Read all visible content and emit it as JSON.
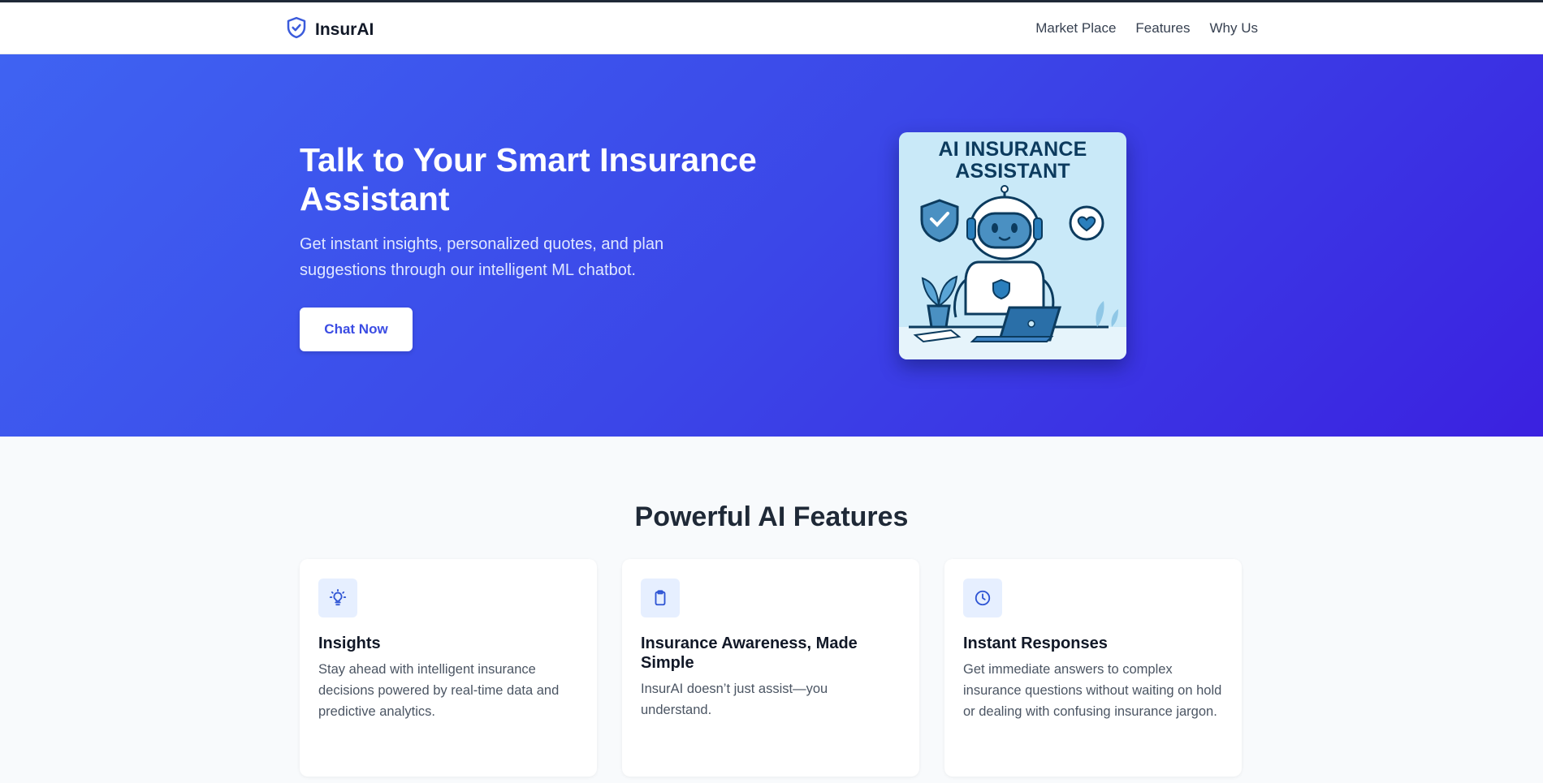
{
  "header": {
    "brand": "InsurAI",
    "nav": [
      {
        "label": "Market Place"
      },
      {
        "label": "Features"
      },
      {
        "label": "Why Us"
      }
    ]
  },
  "hero": {
    "title": "Talk to Your Smart Insurance Assistant",
    "subtitle": "Get instant insights, personalized quotes, and plan suggestions through our intelligent ML chatbot.",
    "cta_label": "Chat Now",
    "image_title_line1": "AI INSURANCE",
    "image_title_line2": "ASSISTANT"
  },
  "features": {
    "heading": "Powerful AI Features",
    "cards": [
      {
        "icon": "lightbulb-icon",
        "title": "Insights",
        "text": "Stay ahead with intelligent insurance decisions powered by real-time data and predictive analytics."
      },
      {
        "icon": "clipboard-icon",
        "title": "Insurance Awareness, Made Simple",
        "text": "InsurAI doesn’t just assist—you understand."
      },
      {
        "icon": "clock-icon",
        "title": "Instant Responses",
        "text": "Get immediate answers to complex insurance questions without waiting on hold or dealing with confusing insurance jargon."
      }
    ]
  },
  "colors": {
    "accent": "#3b4ce3",
    "hero_start": "#3f63f2",
    "hero_end": "#3b21e0",
    "icon_bg": "#e6efff"
  }
}
